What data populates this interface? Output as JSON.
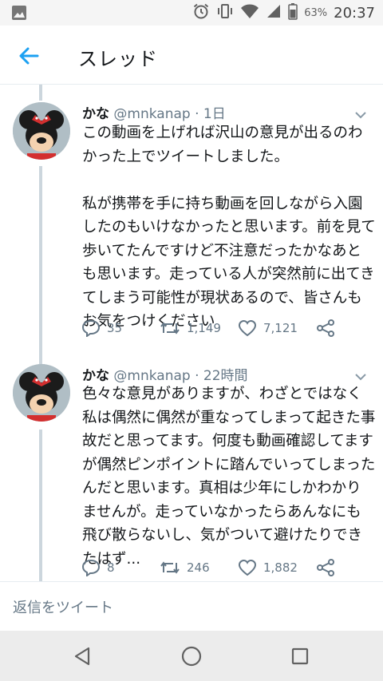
{
  "status_bar": {
    "battery_percent": "63%",
    "time": "20:37"
  },
  "header": {
    "title": "スレッド"
  },
  "tweets": [
    {
      "name": "かな",
      "handle": "@mnkanap",
      "time": "· 1日",
      "text": "この動画を上げれば沢山の意見が出るのわかった上でツイートしました。\n\n私が携帯を手に持ち動画を回しながら入園したのもいけなかったと思います。前を見て歩いてたんですけど不注意だったかなあとも思います。走っている人が突然前に出てきてしまう可能性が現状あるので、皆さんもお気をつけください",
      "replies": "35",
      "retweets": "1,149",
      "likes": "7,121"
    },
    {
      "name": "かな",
      "handle": "@mnkanap",
      "time": "· 22時間",
      "text": "色々な意見がありますが、わざとではなく私は偶然に偶然が重なってしまって起きた事故だと思ってます。何度も動画確認してますが偶然ピンポイントに踏んでいってしまったんだと思います。真相は少年にしかわかりませんが。走っていなかったらあんなにも飛び散らないし、気がついて避けたりできたはず...",
      "replies": "8",
      "retweets": "246",
      "likes": "1,882"
    }
  ],
  "reply_bar": {
    "placeholder": "返信をツイート"
  },
  "icons": {
    "accent": "#1da1f2",
    "muted": "#657786"
  }
}
